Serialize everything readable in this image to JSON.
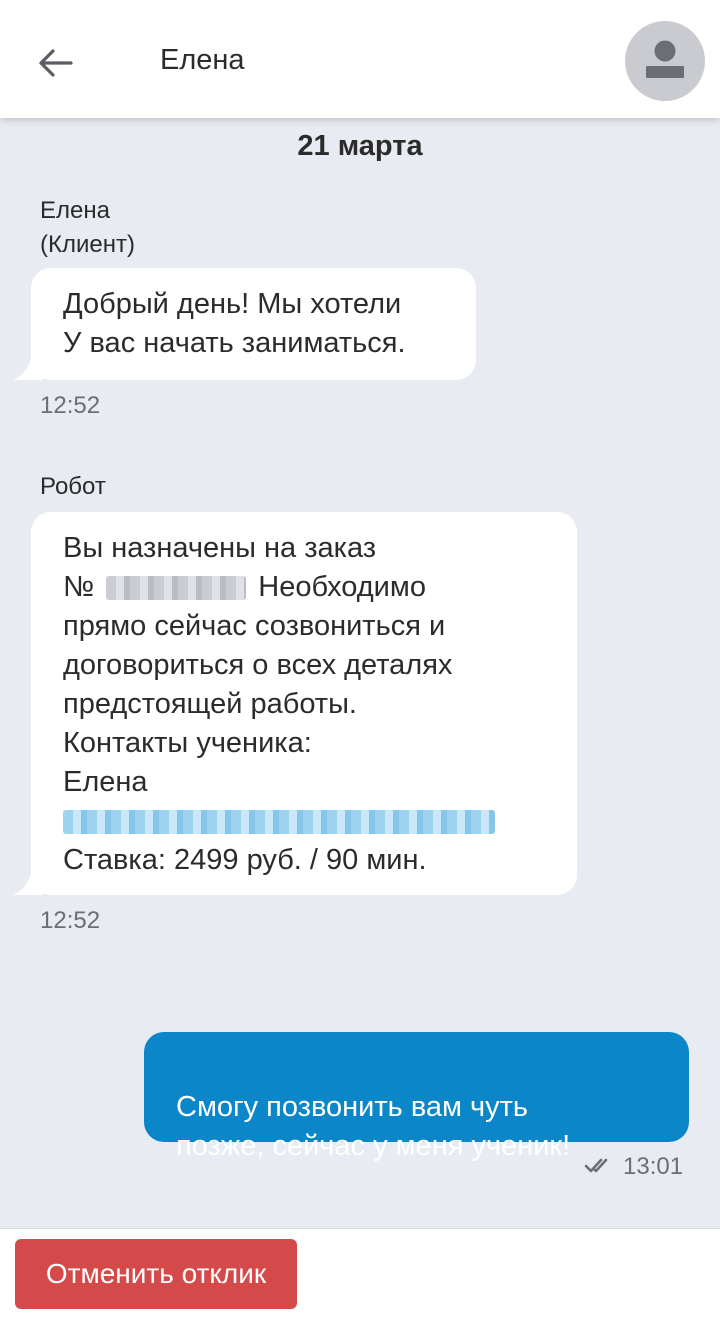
{
  "header": {
    "title": "Елена",
    "back_icon": "arrow-left-icon",
    "avatar_icon": "user-silhouette-icon"
  },
  "chat": {
    "date": "21 марта",
    "messages": [
      {
        "sender_name": "Елена",
        "sender_role": "(Клиент)",
        "lines": [
          "Добрый день! Мы хотели",
          "У  вас начать заниматься."
        ],
        "time": "12:52"
      },
      {
        "sender_name": "Робот",
        "lines": [
          "Вы назначены на заказ",
          "№",
          "Необходимо",
          "прямо сейчас созвониться и",
          "договориться о всех деталях",
          "предстоящей работы.",
          "Контакты ученика:",
          "Елена",
          "Ставка: 2499 руб. / 90 мин."
        ],
        "time": "12:52"
      },
      {
        "outgoing": true,
        "lines": [
          "Смогу позвонить вам чуть",
          "позже, сейчас у меня ученик!"
        ],
        "time": "13:01",
        "status_icon": "double-check-icon"
      }
    ]
  },
  "footer": {
    "cancel_label": "Отменить отклик"
  },
  "colors": {
    "background": "#e8ebf1",
    "outgoing_bubble": "#0b87c9",
    "cancel_button": "#d44a4a"
  }
}
